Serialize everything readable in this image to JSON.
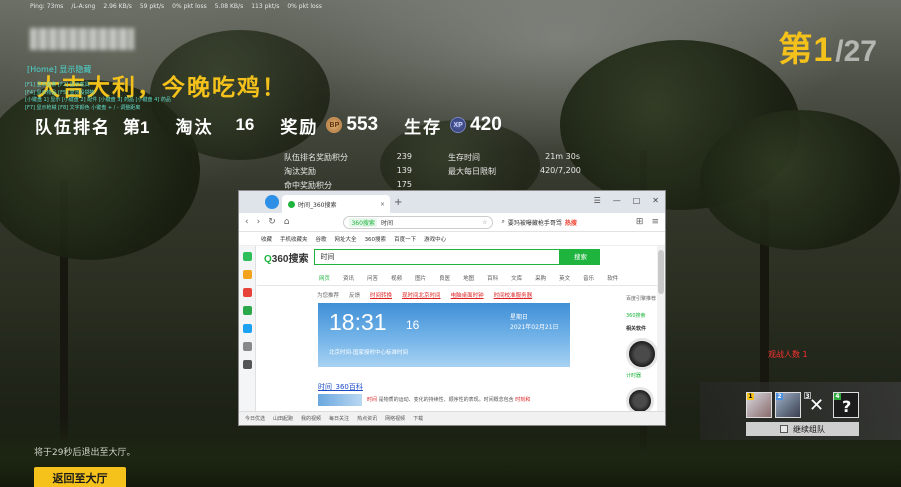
{
  "netbar": [
    "Ping: 73ms",
    "/L-A:sng",
    "2.96 KB/s",
    "59 pkt/s",
    "0% pkt loss",
    "5.08 KB/s",
    "113 pkt/s",
    "0% pkt loss"
  ],
  "rank": {
    "current": "第1",
    "total": "/27"
  },
  "home_hint": "[Home] 显示隐藏",
  "win_title": "大吉大利，今晚吃鸡！",
  "debug_lines": [
    "[F1] 显示血条  [F2] 显示载具",
    "[F4] 显示物品  [F5] 显示投掷物",
    "[小键盘 1] 显示  [小键盘 2] 配件  [小键盘 3] 药品  [小键盘 4] 药品",
    "[F7] 显示枪械  [F8] 文字颜色  小键盘 + / - 调整距离"
  ],
  "stats": {
    "team_rank_label": "队伍排名",
    "team_rank_value": "第1",
    "kills_label": "淘汰",
    "kills_value": "16",
    "reward_label": "奖励",
    "bp_icon": "BP",
    "bp_value": "553",
    "survive_label": "生存",
    "xp_icon": "XP",
    "xp_value": "420"
  },
  "details": [
    {
      "label": "队伍排名奖励积分",
      "value": "239",
      "label2": "生存时间",
      "value2": "21m 30s"
    },
    {
      "label": "淘汰奖励",
      "value": "139",
      "label2": "最大每日限制",
      "value2": "420/7,200"
    },
    {
      "label": "命中奖励积分",
      "value": "175",
      "label2": "",
      "value2": ""
    }
  ],
  "browser": {
    "tab_title": "时间_360搜索",
    "new_tab": "+",
    "address_site": "360搜索",
    "address_text": "时间",
    "news_text": "要玛被曝藏枪手哥骂",
    "news_hot": "热搜",
    "bookmarks": [
      "收藏",
      "手机收藏夹",
      "谷歌",
      "网址大全",
      "360搜索",
      "百度一下",
      "游戏中心"
    ],
    "logo_prefix": "Q",
    "logo_text": "360搜索",
    "search_value": "时间",
    "search_button": "搜索",
    "tabs": [
      "网页",
      "资讯",
      "问答",
      "视频",
      "图片",
      "良医",
      "地图",
      "百科",
      "文库",
      "采购",
      "英文",
      "音乐",
      "软件"
    ],
    "hint_label": "为您推荐",
    "hint_feedback": "反馈",
    "hints": [
      "时间转换",
      "现时间北京时间",
      "电脑桌面时钟",
      "时间校准服务器"
    ],
    "clock_time": "18:31",
    "clock_sec": "16",
    "clock_week": "星期日",
    "clock_date": "2021年02月21日",
    "clock_source": "北京时间-国家授时中心标准时间",
    "result_title": "时间_360百科",
    "result_snip_a": "时间",
    "result_snip_b": "是物质的运动、变化的持续性、顺序性的表现。时间概念包含",
    "result_snip_c": "时刻和",
    "right_panel_title": "百度引擎推荐",
    "right_panel_related": "360搜索",
    "right_panel_soft": "相关软件",
    "right_panel_calc": "计时器",
    "status_items": [
      "今日优选",
      "山田起跑",
      "我的视频",
      "每日关注",
      "热点资讯",
      "网络视频",
      "下载"
    ]
  },
  "team": {
    "dead_label": "观战人数 1",
    "slots": [
      "1",
      "2",
      "3",
      "4"
    ],
    "unknown": "?",
    "continue_label": "继续组队"
  },
  "countdown": "将于29秒后退出至大厅。",
  "return_label": "返回至大厅",
  "colors": {
    "accent": "#f4c21a",
    "search_green": "#1fb43e",
    "danger": "#ff3030"
  }
}
